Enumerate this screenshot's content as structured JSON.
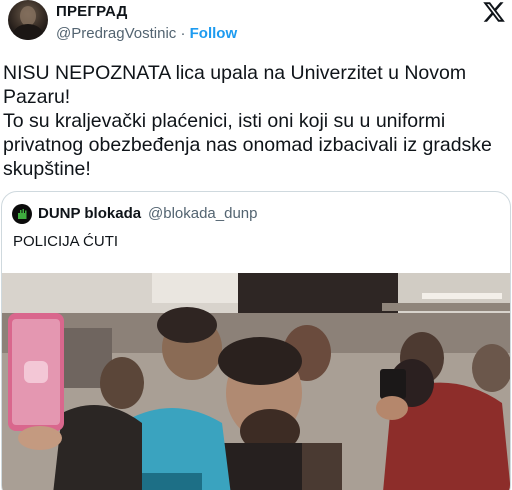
{
  "author": {
    "name": "ПРЕГРАД",
    "handle": "@PredragVostinic",
    "separator": "·",
    "follow_label": "Follow",
    "avatar_icon": "profile-photo"
  },
  "tweet": {
    "paragraph1": "NISU NEPOZNATA lica upala na Univerzitet u Novom Pazaru!",
    "paragraph2": "To su kraljevački plaćenici, isti oni koji su u uniformi privatnog obezbeđenja nas onomad izbacivali iz gradske skupštine!"
  },
  "quoted": {
    "name": "DUNP blokada",
    "handle": "@blokada_dunp",
    "text": "POLICIJA ĆUTI",
    "media_icon": "video-still"
  },
  "colors": {
    "accent": "#1d9bf0",
    "text": "#0f1419",
    "secondary": "#536471",
    "border": "#cfd9de"
  }
}
